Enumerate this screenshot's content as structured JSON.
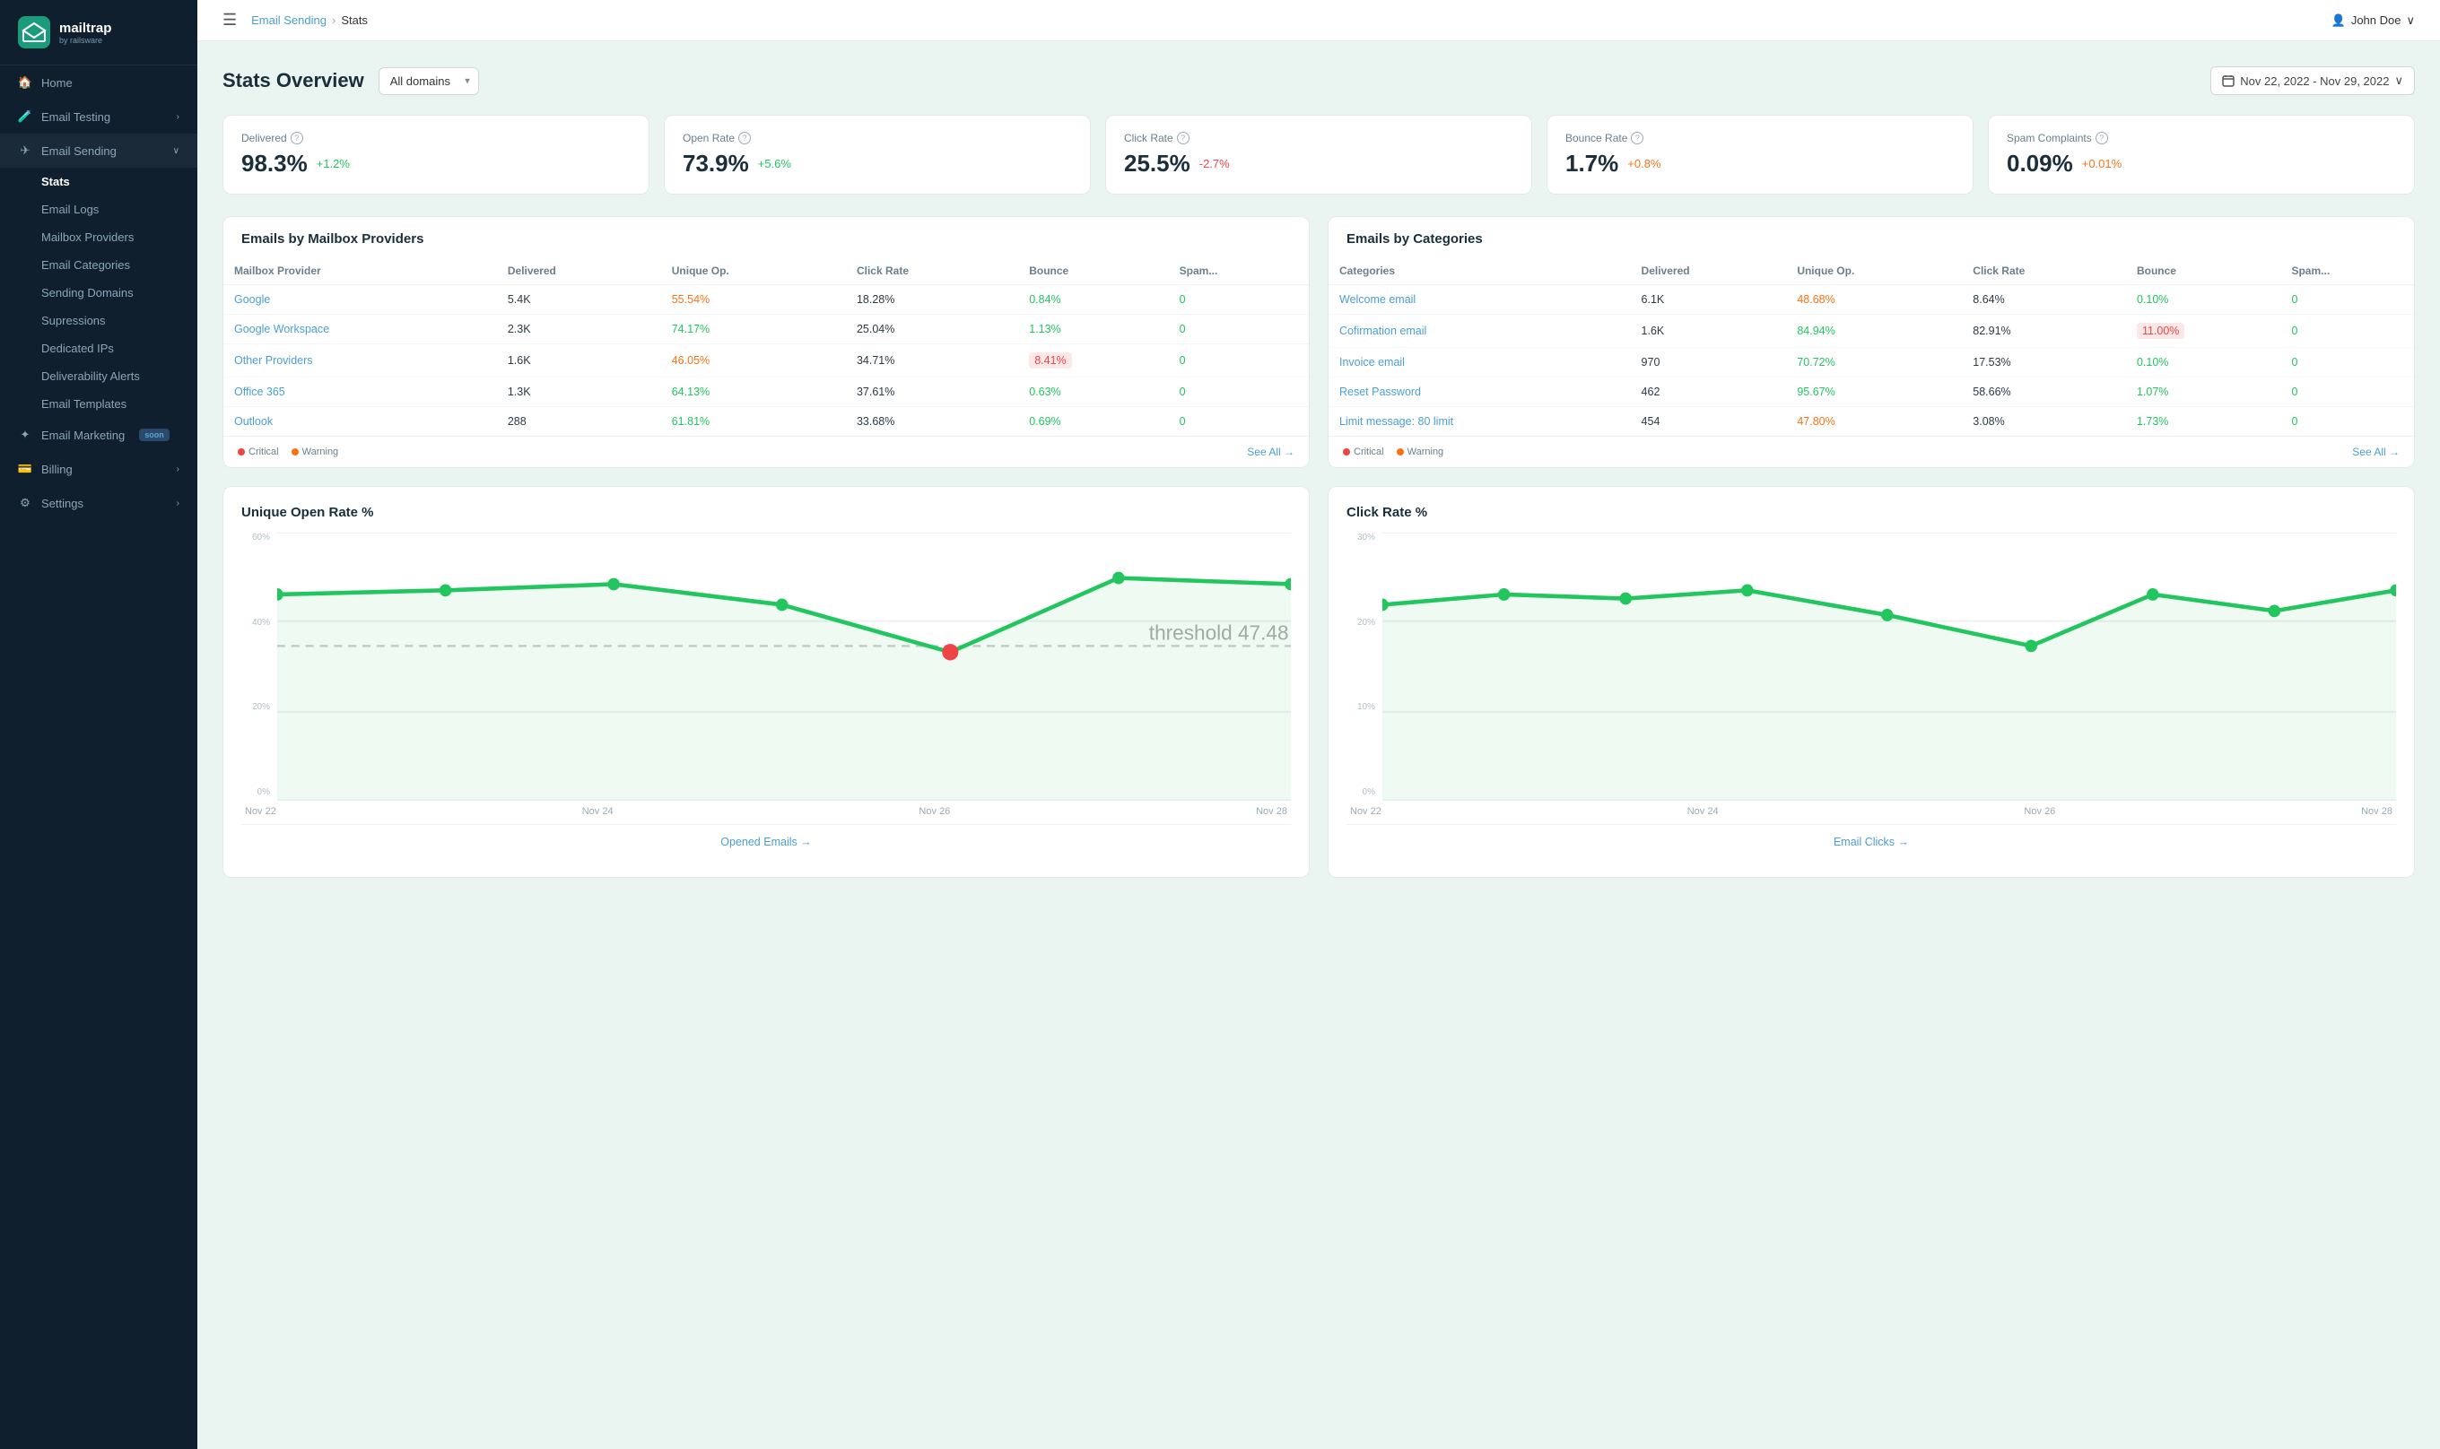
{
  "logo": {
    "name": "mailtrap",
    "sub": "by railsware"
  },
  "sidebar": {
    "items": [
      {
        "id": "home",
        "label": "Home",
        "icon": "home"
      },
      {
        "id": "email-testing",
        "label": "Email Testing",
        "icon": "beaker",
        "arrow": "›"
      },
      {
        "id": "email-sending",
        "label": "Email Sending",
        "icon": "paper-plane",
        "arrow": "∨",
        "active": true,
        "sub": [
          {
            "id": "stats",
            "label": "Stats",
            "active": true
          },
          {
            "id": "email-logs",
            "label": "Email Logs"
          },
          {
            "id": "mailbox-providers",
            "label": "Mailbox Providers"
          },
          {
            "id": "email-categories",
            "label": "Email Categories"
          },
          {
            "id": "sending-domains",
            "label": "Sending Domains"
          },
          {
            "id": "supressions",
            "label": "Supressions"
          },
          {
            "id": "dedicated-ips",
            "label": "Dedicated IPs"
          },
          {
            "id": "deliverability-alerts",
            "label": "Deliverability Alerts"
          },
          {
            "id": "email-templates",
            "label": "Email Templates"
          }
        ]
      },
      {
        "id": "email-marketing",
        "label": "Email Marketing",
        "icon": "star",
        "badge": "soon"
      },
      {
        "id": "billing",
        "label": "Billing",
        "icon": "credit-card",
        "arrow": "›"
      },
      {
        "id": "settings",
        "label": "Settings",
        "icon": "gear",
        "arrow": "›"
      }
    ]
  },
  "topbar": {
    "breadcrumb_link": "Email Sending",
    "breadcrumb_sep": "›",
    "breadcrumb_current": "Stats",
    "user": "John Doe"
  },
  "page": {
    "title": "Stats Overview",
    "domain_placeholder": "All domains",
    "date_range": "Nov 22, 2022 - Nov 29, 2022"
  },
  "kpis": [
    {
      "label": "Delivered",
      "value": "98.3%",
      "delta": "+1.2%",
      "type": "pos"
    },
    {
      "label": "Open Rate",
      "value": "73.9%",
      "delta": "+5.6%",
      "type": "pos"
    },
    {
      "label": "Click Rate",
      "value": "25.5%",
      "delta": "-2.7%",
      "type": "neg"
    },
    {
      "label": "Bounce Rate",
      "value": "1.7%",
      "delta": "+0.8%",
      "type": "warn"
    },
    {
      "label": "Spam Complaints",
      "value": "0.09%",
      "delta": "+0.01%",
      "type": "warn"
    }
  ],
  "mailbox_table": {
    "title": "Emails by Mailbox Providers",
    "headers": [
      "Mailbox Provider",
      "Delivered",
      "Unique Op.",
      "Click Rate",
      "Bounce",
      "Spam..."
    ],
    "rows": [
      {
        "provider": "Google",
        "delivered": "5.4K",
        "unique_op": "55.54%",
        "click_rate": "18.28%",
        "bounce": "0.84%",
        "spam": "0",
        "op_type": "orange",
        "bounce_type": "green"
      },
      {
        "provider": "Google Workspace",
        "delivered": "2.3K",
        "unique_op": "74.17%",
        "click_rate": "25.04%",
        "bounce": "1.13%",
        "spam": "0",
        "op_type": "green",
        "bounce_type": "green"
      },
      {
        "provider": "Other Providers",
        "delivered": "1.6K",
        "unique_op": "46.05%",
        "click_rate": "34.71%",
        "bounce": "8.41%",
        "spam": "0",
        "op_type": "orange",
        "bounce_type": "red-bg"
      },
      {
        "provider": "Office 365",
        "delivered": "1.3K",
        "unique_op": "64.13%",
        "click_rate": "37.61%",
        "bounce": "0.63%",
        "spam": "0",
        "op_type": "green",
        "bounce_type": "green"
      },
      {
        "provider": "Outlook",
        "delivered": "288",
        "unique_op": "61.81%",
        "click_rate": "33.68%",
        "bounce": "0.69%",
        "spam": "0",
        "op_type": "green",
        "bounce_type": "green"
      }
    ],
    "legend_critical": "Critical",
    "legend_warning": "Warning",
    "see_all": "See All →"
  },
  "categories_table": {
    "title": "Emails by Categories",
    "headers": [
      "Categories",
      "Delivered",
      "Unique Op.",
      "Click Rate",
      "Bounce",
      "Spam..."
    ],
    "rows": [
      {
        "category": "Welcome email",
        "delivered": "6.1K",
        "unique_op": "48.68%",
        "click_rate": "8.64%",
        "bounce": "0.10%",
        "spam": "0",
        "op_type": "orange",
        "bounce_type": "green"
      },
      {
        "category": "Cofirmation email",
        "delivered": "1.6K",
        "unique_op": "84.94%",
        "click_rate": "82.91%",
        "bounce": "11.00%",
        "spam": "0",
        "op_type": "green",
        "bounce_type": "red-bg"
      },
      {
        "category": "Invoice email",
        "delivered": "970",
        "unique_op": "70.72%",
        "click_rate": "17.53%",
        "bounce": "0.10%",
        "spam": "0",
        "op_type": "green",
        "bounce_type": "green"
      },
      {
        "category": "Reset Password",
        "delivered": "462",
        "unique_op": "95.67%",
        "click_rate": "58.66%",
        "bounce": "1.07%",
        "spam": "0",
        "op_type": "green",
        "bounce_type": "green"
      },
      {
        "category": "Limit message: 80 limit",
        "delivered": "454",
        "unique_op": "47.80%",
        "click_rate": "3.08%",
        "bounce": "1.73%",
        "spam": "0",
        "op_type": "orange",
        "bounce_type": "green"
      }
    ],
    "legend_critical": "Critical",
    "legend_warning": "Warning",
    "see_all": "See All →"
  },
  "open_rate_chart": {
    "title": "Unique Open Rate %",
    "x_labels": [
      "Nov 22",
      "Nov 24",
      "Nov 26",
      "Nov 28"
    ],
    "y_labels": [
      "60%",
      "40%",
      "20%",
      "0%"
    ],
    "threshold": 47.48,
    "threshold_label": "threshold 47.48",
    "footer_link": "Opened Emails →"
  },
  "click_rate_chart": {
    "title": "Click Rate %",
    "x_labels": [
      "Nov 22",
      "Nov 24",
      "Nov 26",
      "Nov 28"
    ],
    "y_labels": [
      "30%",
      "20%",
      "10%",
      "0%"
    ],
    "footer_link": "Email Clicks →"
  }
}
